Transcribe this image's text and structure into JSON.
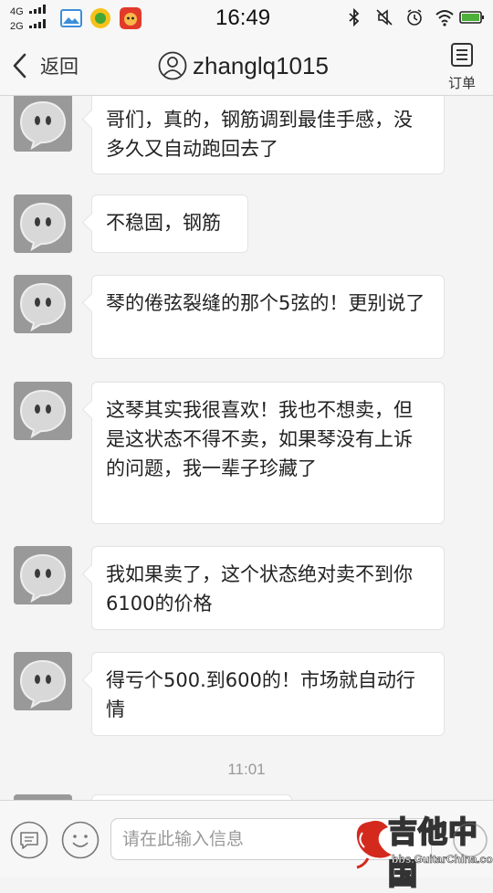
{
  "status_bar": {
    "network_1": "4G",
    "network_2": "2G",
    "time": "16:49"
  },
  "header": {
    "back_label": "返回",
    "title": "zhanglq1015",
    "order_label": "订单"
  },
  "messages": [
    {
      "text": "哥们，真的，钢筋调到最佳手感，没多久又自动跑回去了"
    },
    {
      "text": "不稳固，钢筋"
    },
    {
      "text": "琴的倦弦裂缝的那个5弦的！更别说了"
    },
    {
      "text": "这琴其实我很喜欢！我也不想卖，但是这状态不得不卖，如果琴没有上诉的问题，我一辈子珍藏了"
    },
    {
      "text": "我如果卖了，这个状态绝对卖不到你6100的价格"
    },
    {
      "text": "得亏个500.到600的！市场就自动行情"
    }
  ],
  "timestamp": "11:01",
  "input": {
    "placeholder": "请在此输入信息"
  },
  "watermark": {
    "text": "吉他中国",
    "url": "bbs.GuitarChina.com"
  },
  "colors": {
    "background": "#f4f4f4",
    "bubble": "#ffffff",
    "watermark_red": "#d42a1e"
  }
}
